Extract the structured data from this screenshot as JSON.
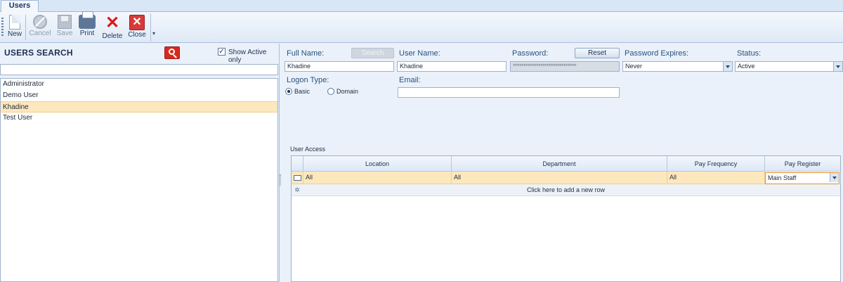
{
  "tab": {
    "label": "Users"
  },
  "toolbar": {
    "new": "New",
    "cancel": "Cancel",
    "save": "Save",
    "print": "Print",
    "delete": "Delete",
    "close": "Close",
    "overflow": "▾"
  },
  "search": {
    "title": "USERS SEARCH",
    "show_active_label": "Show Active only",
    "show_active_checked": "✓",
    "query": "",
    "users": [
      "Administrator",
      "Demo User",
      "Khadine",
      "Test User"
    ],
    "selected_user": "Khadine"
  },
  "form": {
    "full_name_label": "Full Name:",
    "full_name_value": "Khadine",
    "search_button": "Search",
    "user_name_label": "User Name:",
    "user_name_value": "Khadine",
    "password_label": "Password:",
    "password_value": "******************************",
    "reset_button": "Reset",
    "password_expires_label": "Password Expires:",
    "password_expires_value": "Never",
    "status_label": "Status:",
    "status_value": "Active",
    "logon_type_label": "Logon Type:",
    "logon_basic": "Basic",
    "logon_domain": "Domain",
    "logon_selected": "Basic",
    "email_label": "Email:",
    "email_value": ""
  },
  "access": {
    "title": "User Access",
    "columns": [
      "Location",
      "Department",
      "Pay Frequency",
      "Pay Register"
    ],
    "rows": [
      {
        "location": "All",
        "department": "All",
        "pay_frequency": "All",
        "pay_register": "Main Staff"
      }
    ],
    "add_row_text": "Click here to add a new row"
  },
  "colors": {
    "selection": "#fde7bd",
    "accent_red": "#d52b1e",
    "label_blue": "#2a5180"
  }
}
